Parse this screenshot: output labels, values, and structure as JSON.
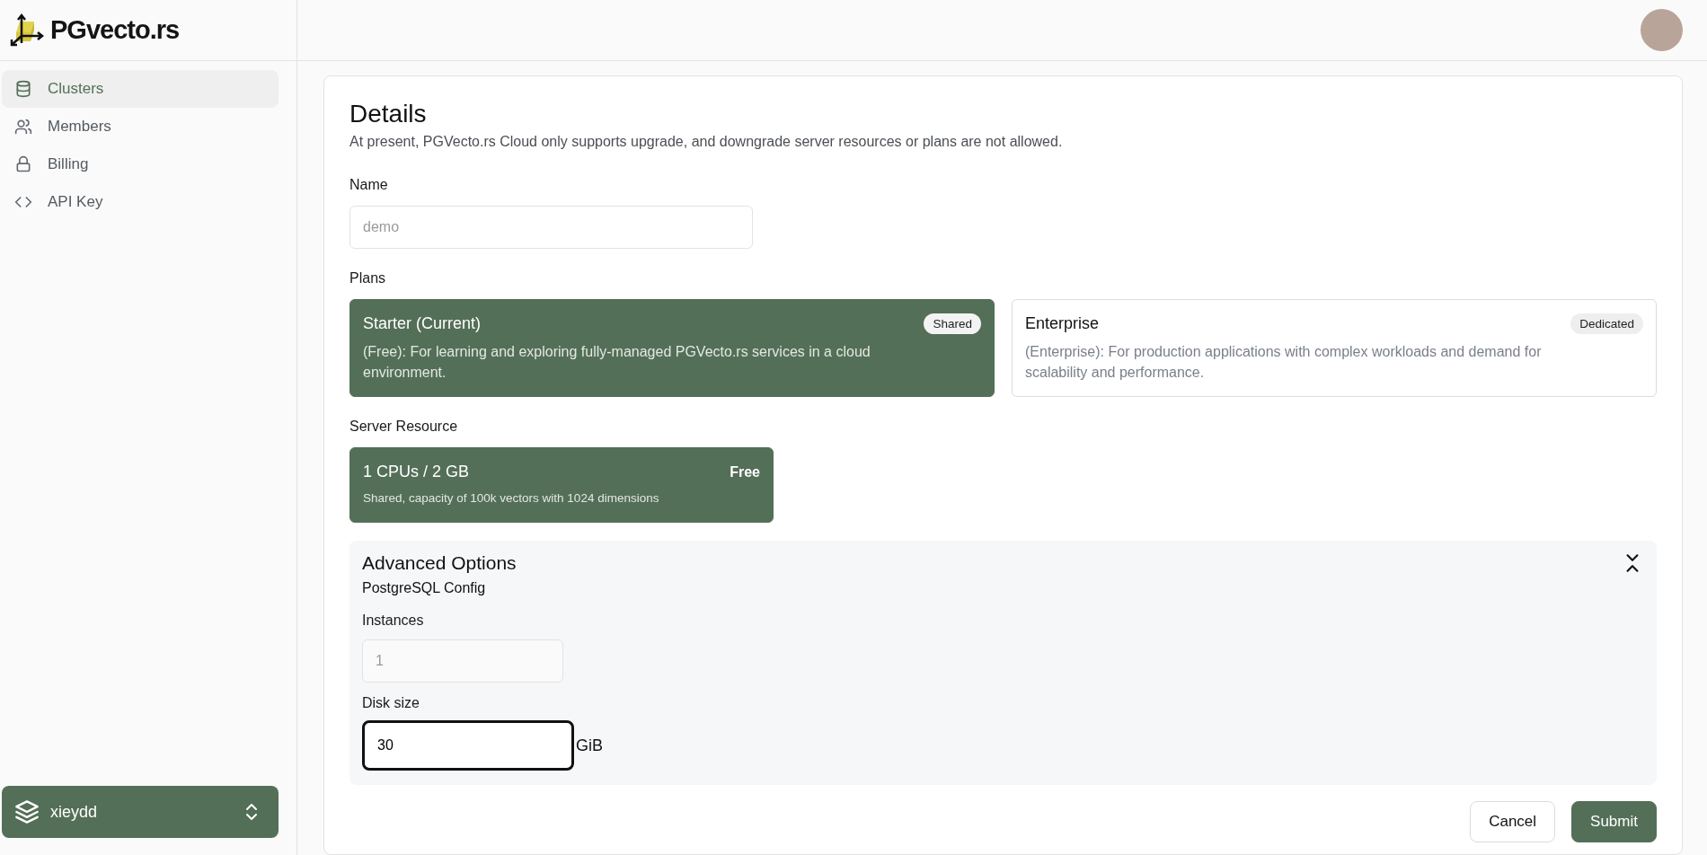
{
  "brand": {
    "name": "PGvecto.rs"
  },
  "sidebar": {
    "items": [
      {
        "label": "Clusters",
        "kind": "database",
        "selected": true
      },
      {
        "label": "Members",
        "kind": "users",
        "selected": false
      },
      {
        "label": "Billing",
        "kind": "lock",
        "selected": false
      },
      {
        "label": "API Key",
        "kind": "code",
        "selected": false
      }
    ],
    "workspace": {
      "name": "xieydd"
    }
  },
  "details": {
    "title": "Details",
    "subtitle": "At present, PGVecto.rs Cloud only supports upgrade, and downgrade server resources or plans are not allowed.",
    "name_field": {
      "label": "Name",
      "placeholder": "demo"
    },
    "plans": {
      "label": "Plans",
      "items": [
        {
          "name": "Starter (Current)",
          "badge": "Shared",
          "description": "(Free): For learning and exploring fully-managed PGVecto.rs services in a cloud environment.",
          "selected": true
        },
        {
          "name": "Enterprise",
          "badge": "Dedicated",
          "description": "(Enterprise): For production applications with complex workloads and demand for scalability and performance.",
          "selected": false
        }
      ]
    },
    "server_resource": {
      "label": "Server Resource",
      "items": [
        {
          "name": "1 CPUs / 2 GB",
          "price": "Free",
          "description": "Shared, capacity of 100k vectors with 1024 dimensions",
          "selected": true
        }
      ]
    },
    "advanced_options": {
      "title": "Advanced Options",
      "expanded": true,
      "subtitle": "PostgreSQL Config",
      "instances": {
        "label": "Instances",
        "placeholder": "1"
      },
      "disk_size": {
        "label": "Disk size",
        "value": "30",
        "unit": "GiB",
        "focused": true
      }
    },
    "buttons": [
      {
        "label": "Cancel",
        "kind": "secondary"
      },
      {
        "label": "Submit",
        "kind": "primary"
      }
    ]
  }
}
